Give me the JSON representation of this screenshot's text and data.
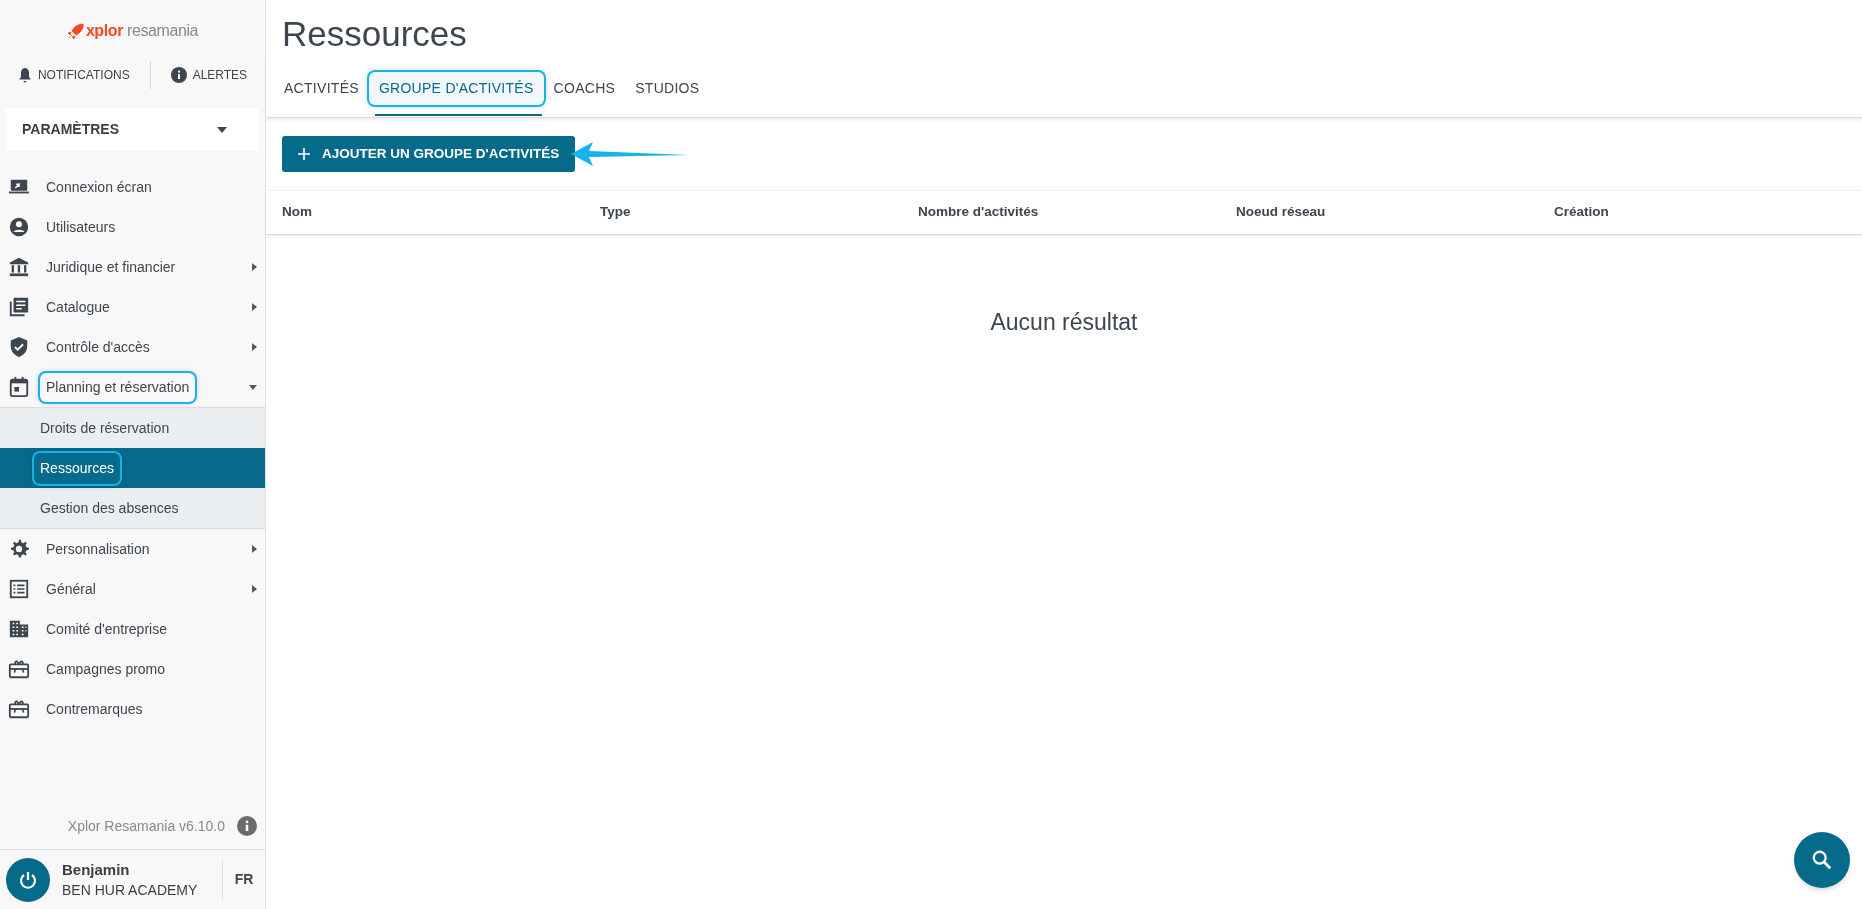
{
  "sidebar": {
    "logo": {
      "brand": "xplor",
      "product": "resamania"
    },
    "top_buttons": [
      {
        "label": "NOTIFICATIONS"
      },
      {
        "label": "ALERTES"
      }
    ],
    "section": {
      "label": "PARAMÈTRES",
      "expanded": true
    },
    "items": [
      {
        "label": "Connexion écran",
        "has_submenu": false,
        "highlighted": false
      },
      {
        "label": "Utilisateurs",
        "has_submenu": false,
        "highlighted": false
      },
      {
        "label": "Juridique et financier",
        "has_submenu": true,
        "expanded": false,
        "highlighted": false
      },
      {
        "label": "Catalogue",
        "has_submenu": true,
        "expanded": false,
        "highlighted": false
      },
      {
        "label": "Contrôle d'accès",
        "has_submenu": true,
        "expanded": false,
        "highlighted": false
      },
      {
        "label": "Planning et réservation",
        "has_submenu": true,
        "expanded": true,
        "highlighted": true,
        "children": [
          {
            "label": "Droits de réservation",
            "selected": false,
            "highlighted": false
          },
          {
            "label": "Ressources",
            "selected": true,
            "highlighted": true
          },
          {
            "label": "Gestion des absences",
            "selected": false,
            "highlighted": false
          }
        ]
      },
      {
        "label": "Personnalisation",
        "has_submenu": true,
        "expanded": false,
        "highlighted": false
      },
      {
        "label": "Général",
        "has_submenu": true,
        "expanded": false,
        "highlighted": false
      },
      {
        "label": "Comité d'entreprise",
        "has_submenu": false,
        "highlighted": false
      },
      {
        "label": "Campagnes promo",
        "has_submenu": false,
        "highlighted": false
      },
      {
        "label": "Contremarques",
        "has_submenu": false,
        "highlighted": false
      }
    ],
    "version": "Xplor Resamania v6.10.0",
    "user": {
      "name": "Benjamin",
      "organization": "BEN HUR ACADEMY",
      "language": "FR"
    }
  },
  "page": {
    "title": "Ressources",
    "tabs": [
      {
        "label": "ACTIVITÉS",
        "selected": false,
        "highlighted": false
      },
      {
        "label": "GROUPE D'ACTIVITÉS",
        "selected": true,
        "highlighted": true
      },
      {
        "label": "COACHS",
        "selected": false,
        "highlighted": false
      },
      {
        "label": "STUDIOS",
        "selected": false,
        "highlighted": false
      }
    ],
    "add_button": {
      "label": "AJOUTER UN GROUPE D'ACTIVITÉS",
      "pointed_at": true
    },
    "table": {
      "columns": [
        "Nom",
        "Type",
        "Nombre d'activités",
        "Noeud réseau",
        "Création"
      ],
      "empty_message": "Aucun résultat"
    }
  }
}
